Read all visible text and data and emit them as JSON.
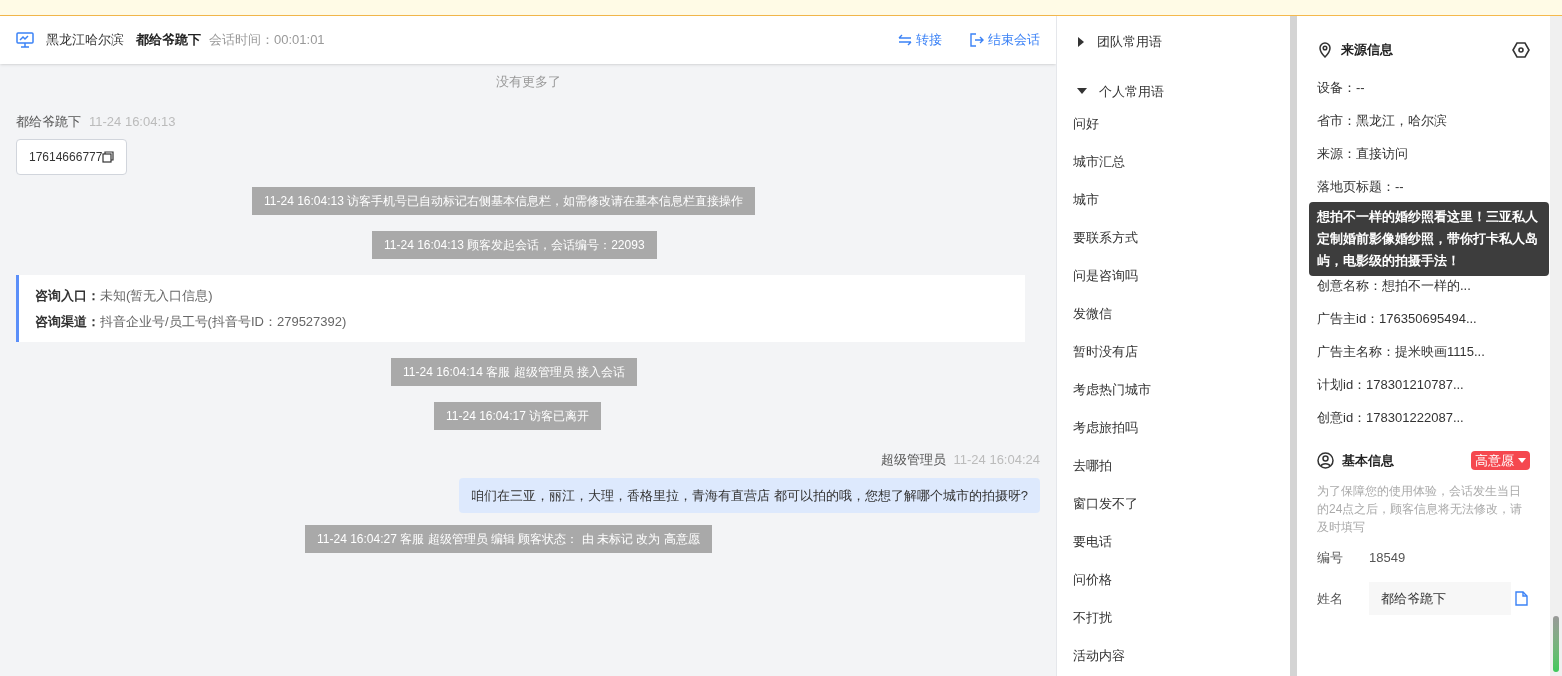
{
  "chat_header": {
    "region": "黑龙江哈尔滨",
    "visitor": "都给爷跪下",
    "session_time": "会话时间：00:01:01",
    "actions": [
      {
        "kind": "transfer",
        "label": "转接"
      },
      {
        "kind": "end",
        "label": "结束会话"
      }
    ]
  },
  "messages": [
    {
      "kind": "notice",
      "text": "没有更多了"
    },
    {
      "kind": "visitor",
      "sender": "都给爷跪下",
      "time": "11-24 16:04:13",
      "text": "17614666777"
    },
    {
      "kind": "system",
      "text": "11-24 16:04:13 访客手机号已自动标记右侧基本信息栏，如需修改请在基本信息栏直接操作"
    },
    {
      "kind": "system",
      "text": "11-24 16:04:13 顾客发起会话，会话编号：22093"
    },
    {
      "kind": "info",
      "lines": [
        {
          "label": "咨询入口：",
          "value": "未知(暂无入口信息)"
        },
        {
          "label": "咨询渠道：",
          "value": "抖音企业号/员工号(抖音号ID：279527392)"
        }
      ]
    },
    {
      "kind": "system",
      "text": "11-24 16:04:14 客服 超级管理员 接入会话"
    },
    {
      "kind": "system",
      "text": "11-24 16:04:17 访客已离开"
    },
    {
      "kind": "agent",
      "sender": "超级管理员",
      "time": "11-24 16:04:24",
      "text": "咱们在三亚，丽江，大理，香格里拉，青海有直营店 都可以拍的哦，您想了解哪个城市的拍摄呀?"
    },
    {
      "kind": "system",
      "text": "11-24 16:04:27 客服 超级管理员 编辑 顾客状态： 由 未标记 改为 高意愿"
    }
  ],
  "phrases": [
    {
      "label": "团队常用语",
      "expanded": false
    },
    {
      "label": "个人常用语",
      "expanded": true,
      "children": [
        "问好",
        "城市汇总",
        "城市",
        "要联系方式",
        "问是咨询吗",
        "发微信",
        "暂时没有店",
        "考虑热门城市",
        "考虑旅拍吗",
        "去哪拍",
        "窗口发不了",
        "要电话",
        "问价格",
        "不打扰",
        "活动内容"
      ]
    }
  ],
  "source_info": {
    "title": "来源信息",
    "rows": [
      "设备：--",
      "省市：黑龙江，哈尔滨",
      "来源：直接访问",
      "落地页标题：--"
    ],
    "tooltip": "想拍不一样的婚纱照看这里！三亚私人定制婚前影像婚纱照，带你打卡私人岛屿，电影级的拍摄手法！",
    "rows_after": [
      "创意名称：想拍不一样的...",
      "广告主id：176350695494...",
      "广告主名称：提米映画1115...",
      "计划id：178301210787...",
      "创意id：178301222087..."
    ]
  },
  "basic_info": {
    "title": "基本信息",
    "status": "高意愿",
    "notice": "为了保障您的使用体验，会话发生当日的24点之后，顾客信息将无法修改，请及时填写",
    "fields": [
      {
        "kind": "text",
        "label": "编号",
        "value": "18549"
      },
      {
        "kind": "input",
        "label": "姓名",
        "value": "都给爷跪下"
      }
    ]
  }
}
